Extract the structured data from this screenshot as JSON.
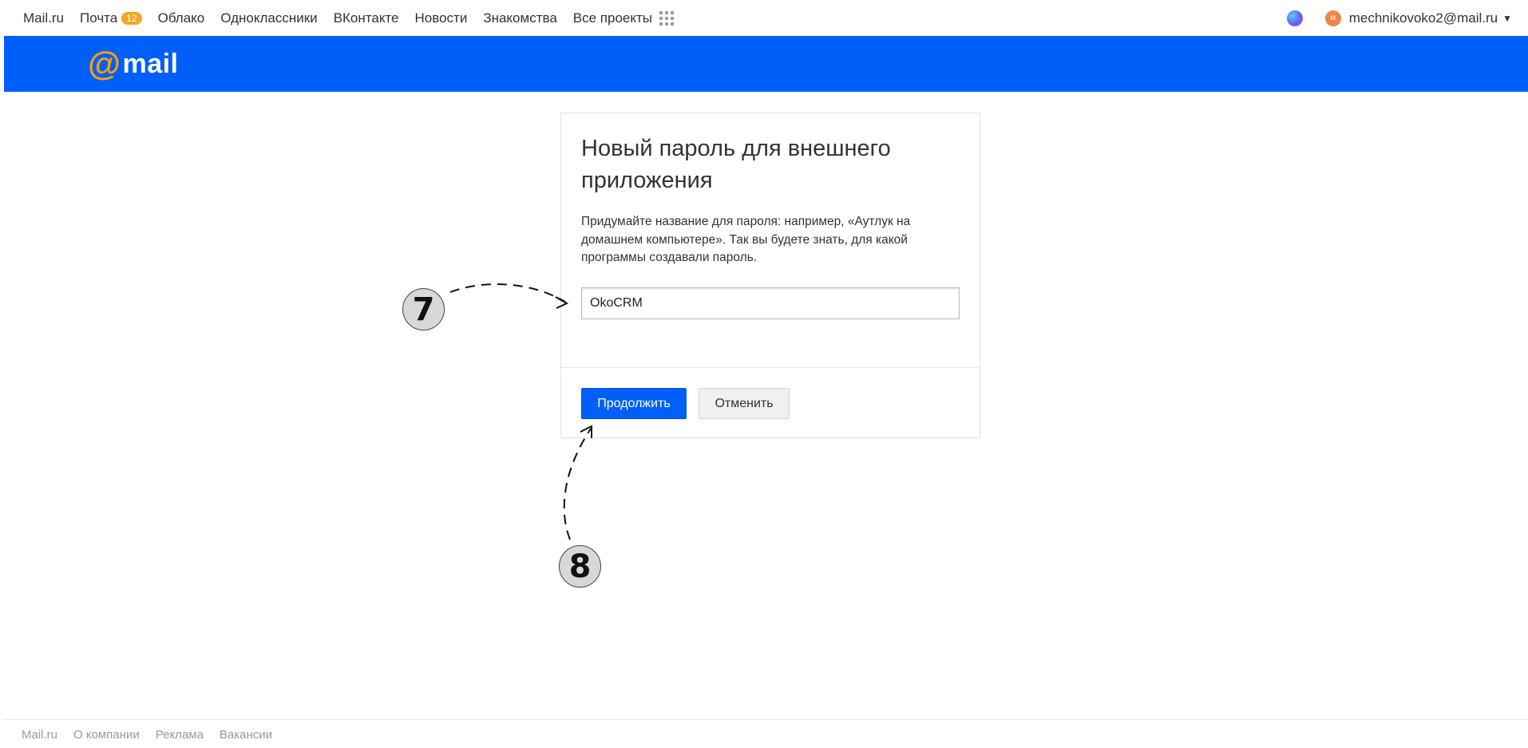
{
  "topbar": {
    "nav": [
      {
        "label": "Mail.ru"
      },
      {
        "label": "Почта",
        "badge": "12"
      },
      {
        "label": "Облако"
      },
      {
        "label": "Одноклассники"
      },
      {
        "label": "ВКонтакте"
      },
      {
        "label": "Новости"
      },
      {
        "label": "Знакомства"
      },
      {
        "label": "Все проекты"
      }
    ],
    "avatar_letter": "м",
    "user_email": "mechnikovoko2@mail.ru"
  },
  "brand": {
    "logo_text": "mail",
    "logo_symbol": "@"
  },
  "card": {
    "title": "Новый пароль для внешнего приложения",
    "description": "Придумайте название для пароля: например, «Аутлук на домашнем компьютере». Так вы будете знать, для какой программы создавали пароль.",
    "input_value": "OkoCRM",
    "continue_label": "Продолжить",
    "cancel_label": "Отменить"
  },
  "annotations": {
    "step_a": "7",
    "step_b": "8"
  },
  "footer": {
    "links": [
      "Mail.ru",
      "О компании",
      "Реклама",
      "Вакансии"
    ]
  },
  "colors": {
    "brand_blue": "#005ff9",
    "badge_orange": "#f5a623",
    "logo_at_orange": "#ff9e00"
  }
}
